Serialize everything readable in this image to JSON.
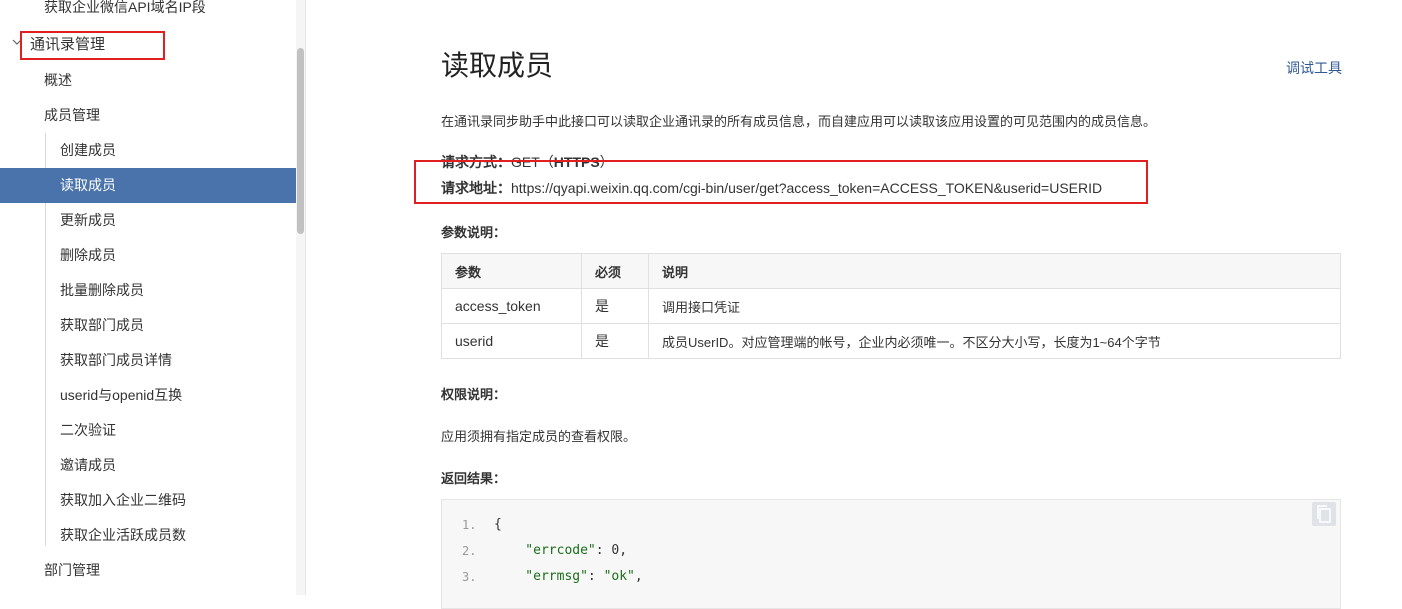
{
  "sidebar": {
    "top_item": "获取企业微信API域名IP段",
    "group_title": "通讯录管理",
    "items": [
      {
        "label": "概述",
        "level": 1
      },
      {
        "label": "成员管理",
        "level": 1
      },
      {
        "label": "创建成员",
        "level": 2
      },
      {
        "label": "读取成员",
        "level": 2,
        "active": true
      },
      {
        "label": "更新成员",
        "level": 2
      },
      {
        "label": "删除成员",
        "level": 2
      },
      {
        "label": "批量删除成员",
        "level": 2
      },
      {
        "label": "获取部门成员",
        "level": 2
      },
      {
        "label": "获取部门成员详情",
        "level": 2
      },
      {
        "label": "userid与openid互换",
        "level": 2
      },
      {
        "label": "二次验证",
        "level": 2
      },
      {
        "label": "邀请成员",
        "level": 2
      },
      {
        "label": "获取加入企业二维码",
        "level": 2
      },
      {
        "label": "获取企业活跃成员数",
        "level": 2
      },
      {
        "label": "部门管理",
        "level": 1
      }
    ]
  },
  "content": {
    "title": "读取成员",
    "debug_tool": "调试工具",
    "intro": "在通讯录同步助手中此接口可以读取企业通讯录的所有成员信息，而自建应用可以读取该应用设置的可见范围内的成员信息。",
    "request_method_label": "请求方式：",
    "request_method_value": "GET（",
    "request_method_https": "HTTPS",
    "request_method_close": "）",
    "request_url_label": "请求地址：",
    "request_url_value": "https://qyapi.weixin.qq.com/cgi-bin/user/get?access_token=ACCESS_TOKEN&userid=USERID",
    "params_heading": "参数说明：",
    "params_table": {
      "headers": [
        "参数",
        "必须",
        "说明"
      ],
      "rows": [
        [
          "access_token",
          "是",
          "调用接口凭证"
        ],
        [
          "userid",
          "是",
          "成员UserID。对应管理端的帐号，企业内必须唯一。不区分大小写，长度为1~64个字节"
        ]
      ]
    },
    "permission_heading": "权限说明：",
    "permission_text": "应用须拥有指定成员的查看权限。",
    "result_heading": "返回结果：",
    "code_lines": [
      {
        "num": "1.",
        "parts": [
          {
            "t": "punc",
            "v": "{"
          }
        ]
      },
      {
        "num": "2.",
        "parts": [
          {
            "t": "key",
            "v": "    \"errcode\""
          },
          {
            "t": "punc",
            "v": ": "
          },
          {
            "t": "num",
            "v": "0"
          },
          {
            "t": "punc",
            "v": ","
          }
        ]
      },
      {
        "num": "3.",
        "parts": [
          {
            "t": "key",
            "v": "    \"errmsg\""
          },
          {
            "t": "punc",
            "v": ": "
          },
          {
            "t": "str",
            "v": "\"ok\""
          },
          {
            "t": "punc",
            "v": ","
          }
        ]
      }
    ]
  },
  "icons": {
    "group_chevron": "chevron-down-icon",
    "copy": "copy-icon"
  },
  "colors": {
    "active_bg": "#4a73ab",
    "highlight_box": "#e02020",
    "link": "#2f5a95"
  }
}
